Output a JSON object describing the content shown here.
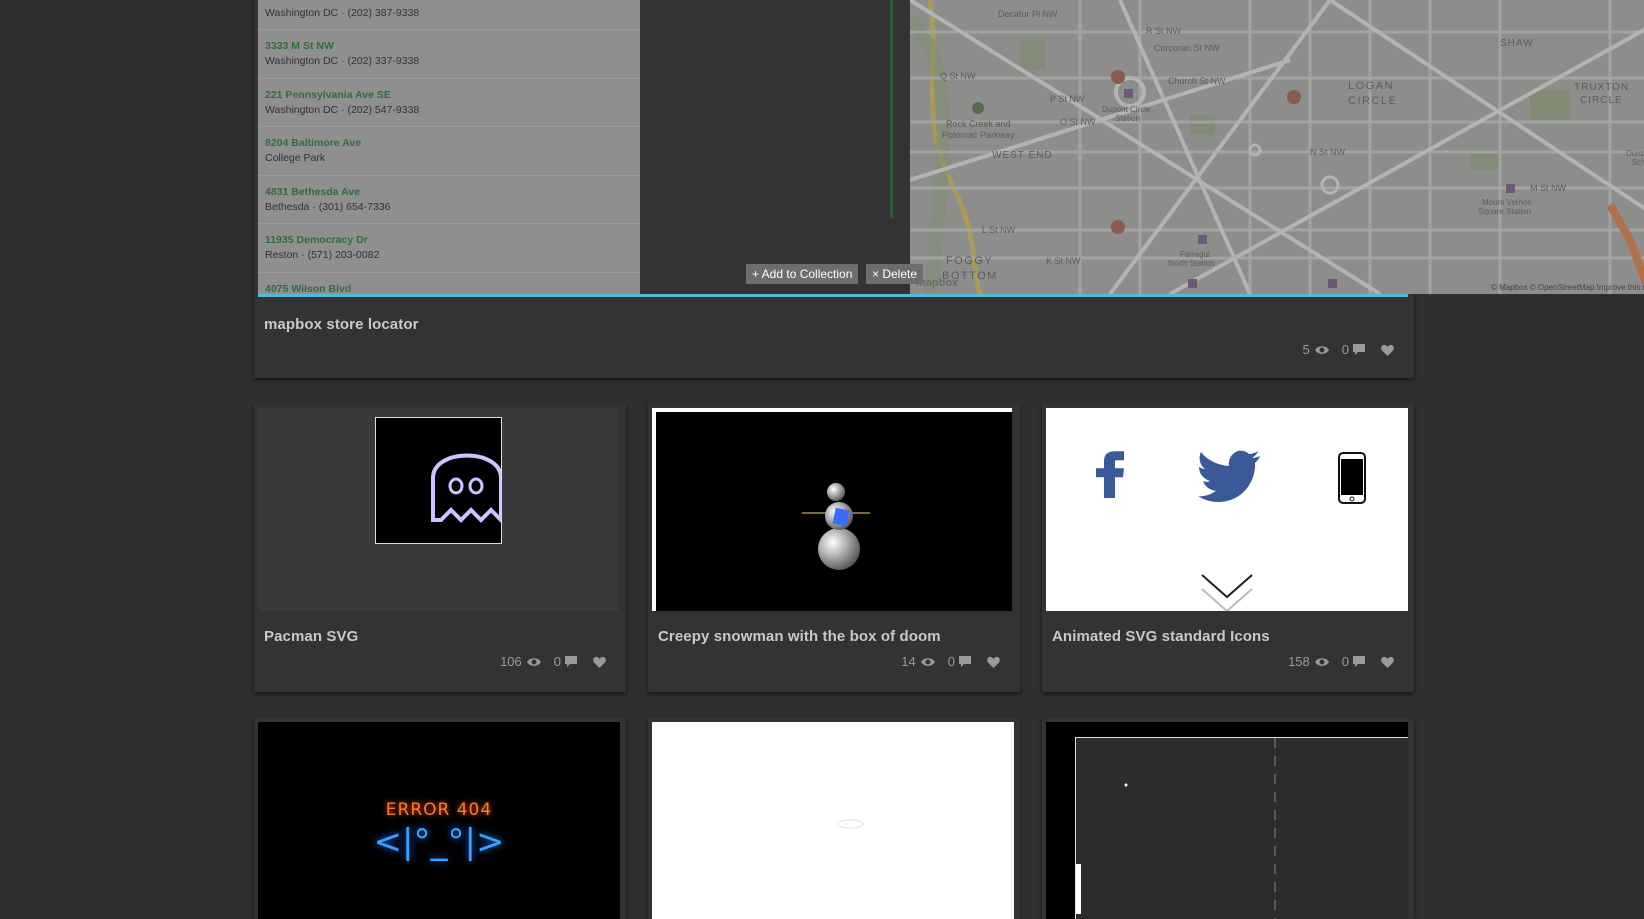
{
  "featured": {
    "title": "mapbox store locator",
    "views": "5",
    "comments": "0",
    "stores": [
      {
        "name": "",
        "sub": "Washington DC · (202) 387-9338"
      },
      {
        "name": "3333 M St NW",
        "sub": "Washington DC · (202) 337-9338"
      },
      {
        "name": "221 Pennsylvania Ave SE",
        "sub": "Washington DC · (202) 547-9338"
      },
      {
        "name": "8204 Baltimore Ave",
        "sub": "College Park"
      },
      {
        "name": "4831 Bethesda Ave",
        "sub": "Bethesda · (301) 654-7336"
      },
      {
        "name": "11935 Democracy Dr",
        "sub": "Reston · (571) 203-0082"
      },
      {
        "name": "4075 Wilson Blvd",
        "sub": ""
      }
    ],
    "map_labels": {
      "decatur": "Decatur Pl NW",
      "r_st": "R St NW",
      "corcoran": "Corcoran St NW",
      "church": "Church St NW",
      "q_st": "Q St NW",
      "p_st": "P St NW",
      "o_st": "O St NW",
      "n_st": "N St NW",
      "m_st": "M St NW",
      "l_st": "L St NW",
      "k_st": "K St NW",
      "shaw": "SHAW",
      "logan": "LOGAN",
      "circle": "CIRCLE",
      "truxton": "TRUXTON",
      "truxton2": "CIRCLE",
      "west_end": "WEST END",
      "foggy": "FOGGY",
      "bottom": "BOTTOM",
      "rock_creek": "Rock Creek and",
      "potomac": "Potomac Parkway",
      "dupont": "Dupont Circle",
      "station": "Station",
      "farragut": "Farragut",
      "north_station": "North Station",
      "mount_vernon": "Mount Vernon",
      "square_station": "Square Station",
      "dunbar": "Dunbar Hi",
      "school": "School",
      "attribution": "© Mapbox © OpenStreetMap  Improve this map",
      "logo": "mapbox"
    },
    "add_to_collection": "+ Add to Collection",
    "delete": "× Delete"
  },
  "cards": [
    {
      "title": "Pacman SVG",
      "views": "106",
      "comments": "0"
    },
    {
      "title": "Creepy snowman with the box of doom",
      "views": "14",
      "comments": "0"
    },
    {
      "title": "Animated SVG standard Icons",
      "views": "158",
      "comments": "0"
    }
  ],
  "error_card": {
    "line1": "ERROR 404",
    "line2": "<|°_°|>"
  },
  "colors": {
    "background": "#2f2f31",
    "card": "#333335",
    "accent_green": "#2f6e3a",
    "map_bar": "#58b9d6",
    "icon_blue": "#3b5998"
  }
}
